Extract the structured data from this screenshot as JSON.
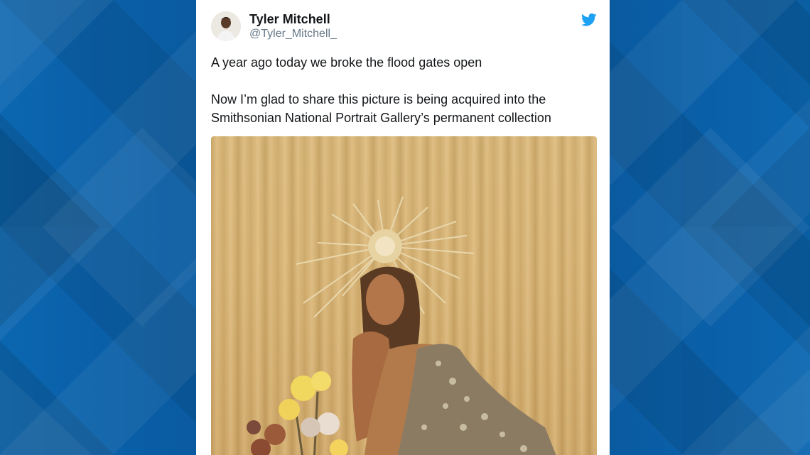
{
  "tweet": {
    "author_name": "Tyler Mitchell",
    "author_handle": "@Tyler_Mitchell_",
    "line1": "A year ago today we broke the flood gates open",
    "line2": "Now I’m glad to share this picture is being acquired into the",
    "line3": "Smithsonian National Portrait Gallery’s permanent collection",
    "platform_icon": "twitter-bird-icon",
    "accent_color": "#1da1f2"
  },
  "background": {
    "color": "#0a5fa6"
  }
}
